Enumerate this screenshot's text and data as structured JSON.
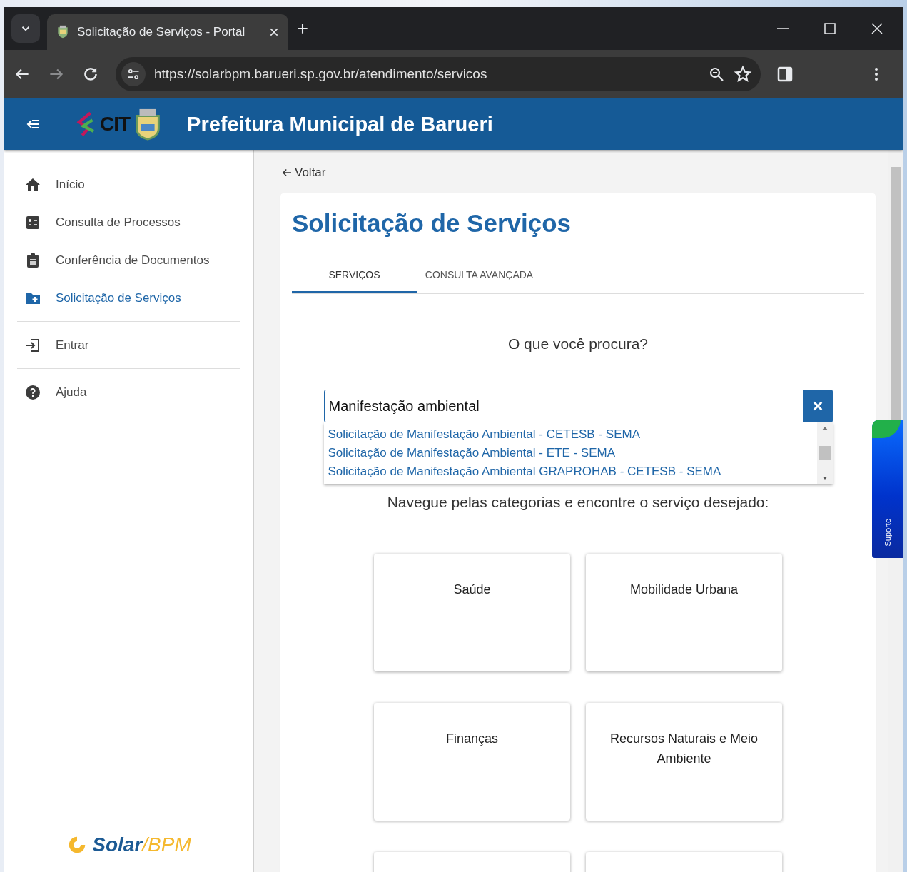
{
  "browser": {
    "tab_title": "Solicitação de Serviços - Portal",
    "url": "https://solarbpm.barueri.sp.gov.br/atendimento/servicos"
  },
  "header": {
    "logo_text": "CIT",
    "title": "Prefeitura Municipal de Barueri"
  },
  "sidebar": {
    "sections": [
      [
        {
          "label": "Início",
          "selected": false
        },
        {
          "label": "Consulta de Processos",
          "selected": false
        },
        {
          "label": "Conferência de Documentos",
          "selected": false
        },
        {
          "label": "Solicitação de Serviços",
          "selected": true
        }
      ],
      [
        {
          "label": "Entrar",
          "selected": false
        }
      ],
      [
        {
          "label": "Ajuda",
          "selected": false
        }
      ]
    ],
    "brand": {
      "part_1": "Solar",
      "part_2": "/BPM"
    }
  },
  "main": {
    "back_link": "Voltar",
    "title": "Solicitação de Serviços",
    "tabs": [
      {
        "label": "SERVIÇOS",
        "selected": true
      },
      {
        "label": "CONSULTA AVANÇADA",
        "selected": false
      }
    ],
    "question": "O que você procura?",
    "search": {
      "value": "Manifestação ambiental"
    },
    "suggestions": [
      "Solicitação de Manifestação Ambiental - CETESB - SEMA",
      "Solicitação de Manifestação Ambiental - ETE - SEMA",
      "Solicitação de Manifestação Ambiental GRAPROHAB - CETESB - SEMA"
    ],
    "browse_hint": "Navegue pelas categorias e encontre o serviço desejado:",
    "categories": [
      {
        "label": "Saúde"
      },
      {
        "label": "Mobilidade Urbana"
      },
      {
        "label": "Finanças"
      },
      {
        "label": "Recursos Naturais e Meio Ambiente"
      },
      {
        "cut_off": true
      },
      {
        "cut_off": true
      }
    ]
  },
  "support_tab": {
    "label": "Suporte"
  }
}
